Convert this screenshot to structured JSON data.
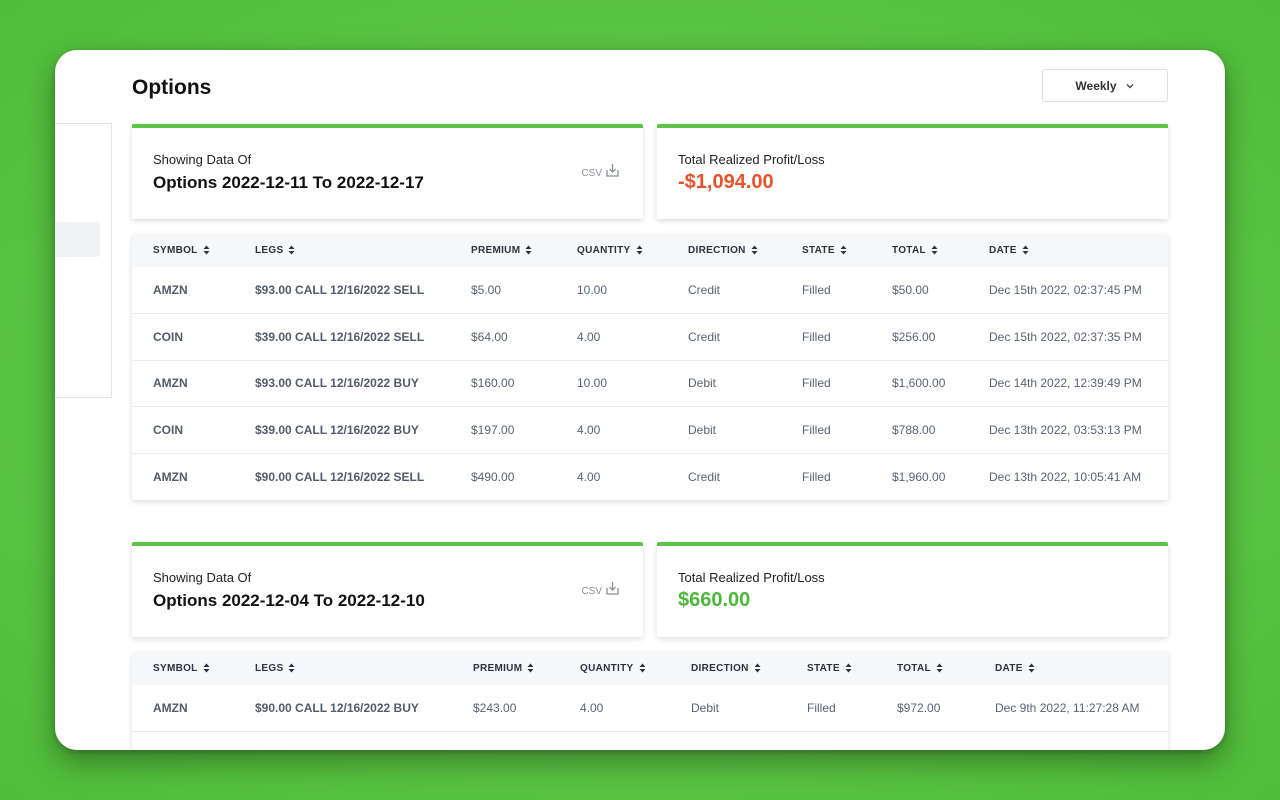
{
  "page": {
    "title": "Options"
  },
  "period_select": {
    "value": "Weekly"
  },
  "columns": [
    "SYMBOL",
    "LEGS",
    "PREMIUM",
    "QUANTITY",
    "DIRECTION",
    "STATE",
    "TOTAL",
    "DATE"
  ],
  "sections": [
    {
      "showing_label": "Showing Data Of",
      "range_title": "Options 2022-12-11 To 2022-12-17",
      "csv_label": "CSV",
      "pl_label": "Total Realized Profit/Loss",
      "pl_value": "-$1,094.00",
      "pl_color": "#e8522b",
      "rows": [
        [
          "AMZN",
          "$93.00 CALL 12/16/2022 SELL",
          "$5.00",
          "10.00",
          "Credit",
          "Filled",
          "$50.00",
          "Dec 15th 2022, 02:37:45 PM"
        ],
        [
          "COIN",
          "$39.00 CALL 12/16/2022 SELL",
          "$64.00",
          "4.00",
          "Credit",
          "Filled",
          "$256.00",
          "Dec 15th 2022, 02:37:35 PM"
        ],
        [
          "AMZN",
          "$93.00 CALL 12/16/2022 BUY",
          "$160.00",
          "10.00",
          "Debit",
          "Filled",
          "$1,600.00",
          "Dec 14th 2022, 12:39:49 PM"
        ],
        [
          "COIN",
          "$39.00 CALL 12/16/2022 BUY",
          "$197.00",
          "4.00",
          "Debit",
          "Filled",
          "$788.00",
          "Dec 13th 2022, 03:53:13 PM"
        ],
        [
          "AMZN",
          "$90.00 CALL 12/16/2022 SELL",
          "$490.00",
          "4.00",
          "Credit",
          "Filled",
          "$1,960.00",
          "Dec 13th 2022, 10:05:41 AM"
        ]
      ]
    },
    {
      "showing_label": "Showing Data Of",
      "range_title": "Options 2022-12-04 To 2022-12-10",
      "csv_label": "CSV",
      "pl_label": "Total Realized Profit/Loss",
      "pl_value": "$660.00",
      "pl_color": "#4cb83a",
      "rows": [
        [
          "AMZN",
          "$90.00 CALL 12/16/2022 BUY",
          "$243.00",
          "4.00",
          "Debit",
          "Filled",
          "$972.00",
          "Dec 9th 2022, 11:27:28 AM"
        ],
        [
          "",
          "",
          "",
          "",
          "",
          "",
          "",
          ""
        ]
      ]
    }
  ],
  "colors": {
    "accent": "#5cc545",
    "loss": "#e8522b",
    "profit": "#4cb83a"
  },
  "icons": {
    "csv": "download-tray-icon",
    "dropdown": "chevron-down-icon",
    "sort": "sort-icon"
  }
}
